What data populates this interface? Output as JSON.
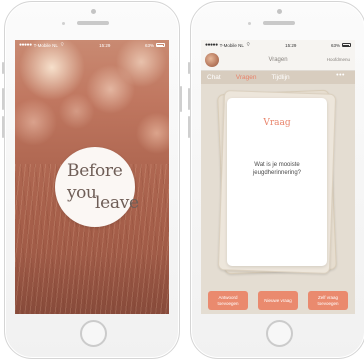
{
  "status_bar": {
    "carrier": "T-Mobile NL",
    "time": "15:29",
    "battery": "63%"
  },
  "splash": {
    "logo_line1": "Before",
    "logo_line2": "you",
    "logo_line3": "leave"
  },
  "app": {
    "nav_title": "Vragen",
    "nav_right": "Hoofdmenu",
    "tabs": [
      {
        "label": "Chat"
      },
      {
        "label": "Vragen"
      },
      {
        "label": "Tijdlijn"
      }
    ],
    "active_tab": "Vragen",
    "more_label": "•••",
    "card": {
      "heading": "Vraag",
      "question": "Wat is je mooiste jeugdherinnering?"
    },
    "actions": [
      {
        "label": "Antwoord toevoegen"
      },
      {
        "label": "Nieuwe vraag"
      },
      {
        "label": "Zelf vraag toevoegen"
      }
    ]
  },
  "colors": {
    "accent": "#ea8a6e",
    "tab_bar": "#d8cdbf",
    "card_heading": "#e8836a"
  }
}
